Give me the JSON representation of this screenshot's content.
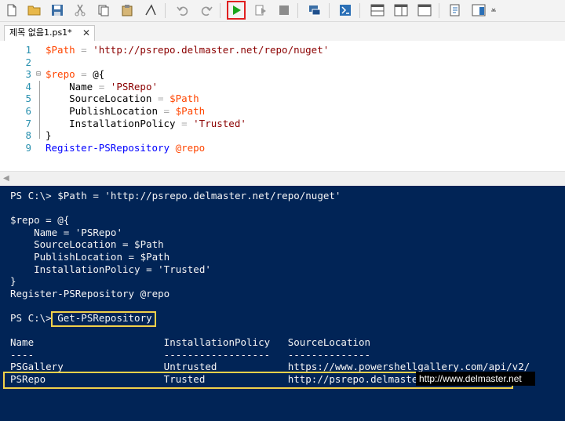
{
  "toolbar": {
    "buttons": [
      "new-script",
      "open",
      "save",
      "cut",
      "copy",
      "paste",
      "clear",
      "undo",
      "redo",
      "run-script",
      "run-selection",
      "stop",
      "new-remote-tab",
      "start-powershell",
      "show-script-pane-top",
      "show-script-pane-right",
      "show-script-pane-maximized",
      "show-command-window",
      "show-command-addon",
      "toolbar-more"
    ]
  },
  "tab": {
    "title": "제목 없음1.ps1*",
    "close": "✕"
  },
  "editor": {
    "line_numbers": [
      "1",
      "2",
      "3",
      "4",
      "5",
      "6",
      "7",
      "8",
      "9"
    ],
    "lines": [
      [
        [
          "var",
          "$Path"
        ],
        [
          "op",
          " = "
        ],
        [
          "str",
          "'http://psrepo.delmaster.net/repo/nuget'"
        ]
      ],
      [],
      [
        [
          "var",
          "$repo"
        ],
        [
          "op",
          " = "
        ],
        [
          "plain",
          "@{"
        ]
      ],
      [
        [
          "plain",
          "    Name "
        ],
        [
          "op",
          "= "
        ],
        [
          "str",
          "'PSRepo'"
        ]
      ],
      [
        [
          "plain",
          "    SourceLocation "
        ],
        [
          "op",
          "= "
        ],
        [
          "var",
          "$Path"
        ]
      ],
      [
        [
          "plain",
          "    PublishLocation "
        ],
        [
          "op",
          "= "
        ],
        [
          "var",
          "$Path"
        ]
      ],
      [
        [
          "plain",
          "    InstallationPolicy "
        ],
        [
          "op",
          "= "
        ],
        [
          "str",
          "'Trusted'"
        ]
      ],
      [
        [
          "plain",
          "}"
        ]
      ],
      [
        [
          "cmd",
          "Register-PSRepository "
        ],
        [
          "var",
          "@repo"
        ]
      ]
    ]
  },
  "console": {
    "lines": [
      "PS C:\\> $Path = 'http://psrepo.delmaster.net/repo/nuget'",
      "",
      "$repo = @{",
      "    Name = 'PSRepo'",
      "    SourceLocation = $Path",
      "    PublishLocation = $Path",
      "    InstallationPolicy = 'Trusted'",
      "}",
      "Register-PSRepository @repo",
      "",
      "PS C:\\> Get-PSRepository",
      "",
      "Name                      InstallationPolicy   SourceLocation",
      "----                      ------------------   --------------",
      "PSGallery                 Untrusted            https://www.powershellgallery.com/api/v2/",
      "PSRepo                    Trusted              http://psrepo.delmaster.net/repo/nuget"
    ]
  },
  "tooltip": "http://www.delmaster.net",
  "colors": {
    "console_bg": "#012456",
    "highlight_box": "#f1d14a",
    "run_highlight": "#e02020",
    "run_green": "#1aa51a"
  }
}
